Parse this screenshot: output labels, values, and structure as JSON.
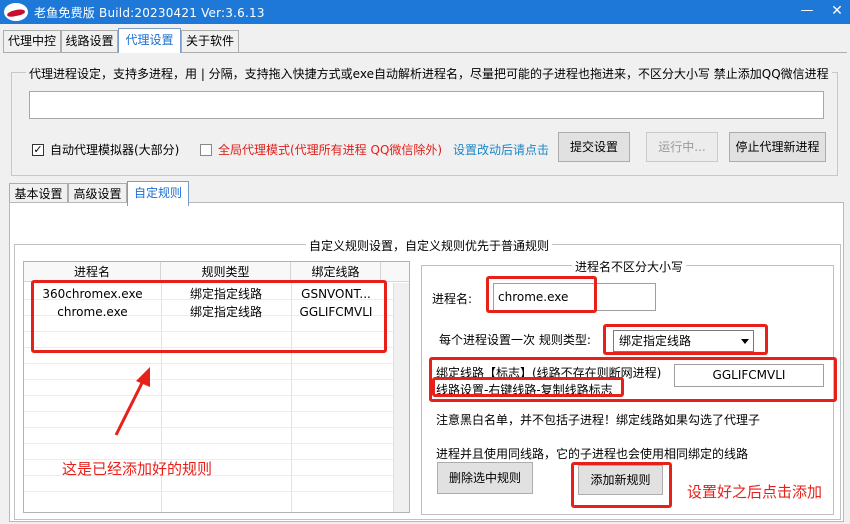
{
  "window": {
    "title": "老鱼免费版 Build:20230421 Ver:3.6.13",
    "min_glyph": "—",
    "close_glyph": "✕"
  },
  "main_tabs": [
    {
      "label": "代理中控"
    },
    {
      "label": "线路设置"
    },
    {
      "label": "代理设置"
    },
    {
      "label": "关于软件"
    }
  ],
  "process_group": {
    "legend": "代理进程设定，支持多进程，用 | 分隔，支持拖入快捷方式或exe自动解析进程名，尽量把可能的子进程也拖进来，不区分大小写 禁止添加QQ微信进程",
    "input_value": "",
    "auto_proxy_checked_glyph": "✓",
    "auto_proxy_label": "自动代理模拟器(大部分)",
    "global_mode_label": "全局代理模式(代理所有进程 QQ微信除外)",
    "hint_link": "设置改动后请点击",
    "submit_label": "提交设置",
    "running_label": "运行中...",
    "stop_label": "停止代理新进程"
  },
  "sub_tabs": [
    {
      "label": "基本设置"
    },
    {
      "label": "高级设置"
    },
    {
      "label": "自定规则"
    }
  ],
  "custom_rules": {
    "legend": "自定义规则设置，自定义规则优先于普通规则",
    "table": {
      "columns": [
        "进程名",
        "规则类型",
        "绑定线路"
      ],
      "rows": [
        [
          "360chromex.exe",
          "绑定指定线路",
          "GSNVONT..."
        ],
        [
          "chrome.exe",
          "绑定指定线路",
          "GGLIFCMVLI"
        ]
      ]
    },
    "right_panel": {
      "legend": "进程名不区分大小写",
      "process_label": "进程名:",
      "process_value": "chrome.exe",
      "rule_type_label": "每个进程设置一次 规则类型:",
      "rule_type_value": "绑定指定线路",
      "bind_line_label": "绑定线路【标志】(线路不存在则断网进程)",
      "bind_line_hint": "线路设置-右键线路-复制线路标志",
      "bind_line_value": "GGLIFCMVLI",
      "note1": "注意黑白名单，并不包括子进程！绑定线路如果勾选了代理子",
      "note2": "进程并且使用同线路，它的子进程也会使用相同绑定的线路",
      "delete_label": "删除选中规则",
      "add_label": "添加新规则"
    }
  },
  "annotations": {
    "left_text": "这是已经添加好的规则",
    "right_text": "设置好之后点击添加",
    "color": "#e8201a"
  }
}
